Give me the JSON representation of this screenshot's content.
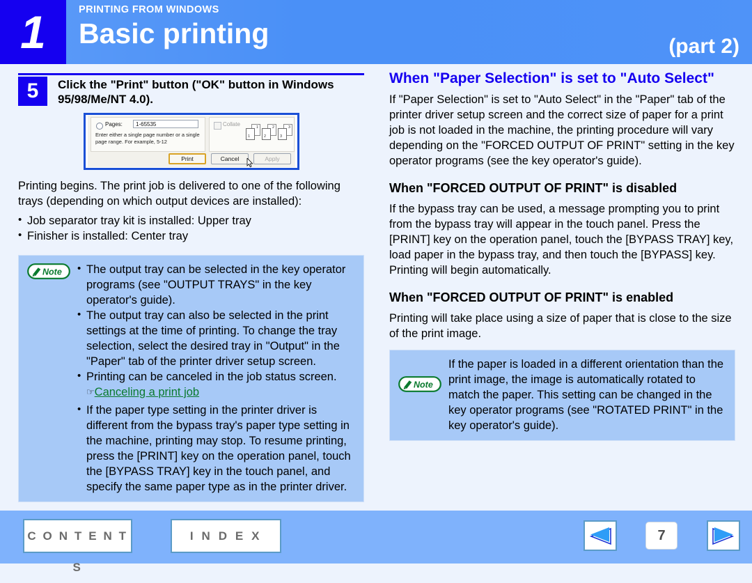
{
  "header": {
    "chapter_number": "1",
    "kicker": "PRINTING FROM WINDOWS",
    "title": "Basic printing",
    "part_label": "(part 2)"
  },
  "left_column": {
    "step": {
      "number": "5",
      "text": "Click the \"Print\" button (\"OK\" button in Windows 95/98/Me/NT 4.0)."
    },
    "dialog_screenshot": {
      "radio_label": "Pages:",
      "page_range_value": "1-65535",
      "hint": "Enter either a single page number or a single page range.  For example, 5-12",
      "collate_label": "Collate",
      "sheet_numbers": [
        "1",
        "1",
        "2",
        "2",
        "3",
        "3"
      ],
      "buttons": {
        "print": "Print",
        "cancel": "Cancel",
        "apply": "Apply"
      }
    },
    "paragraph": "Printing begins. The print job is delivered to one of the following trays (depending on which output devices are installed):",
    "tray_list": [
      "Job separator tray kit is installed: Upper tray",
      "Finisher is installed: Center tray"
    ],
    "note": {
      "badge_label": "Note",
      "bullets": [
        "The output tray can be selected in the key operator programs (see \"OUTPUT TRAYS\" in the key operator's guide).",
        "The output tray can also be selected in the print settings at the time of printing. To change the tray selection, select the desired tray in \"Output\" in the \"Paper\" tab of the printer driver setup screen.",
        "Printing can be canceled in the job status screen.",
        "If the paper type setting in the printer driver is different from the bypass tray's paper type setting in the machine, printing may stop. To resume printing, press the [PRINT] key on the operation panel, touch the [BYPASS TRAY] key in the touch panel, and specify the same paper type as in the printer driver."
      ],
      "cross_reference_link": "Canceling a print job"
    }
  },
  "right_column": {
    "heading_main": "When \"Paper Selection\" is set to \"Auto Select\"",
    "intro_paragraph": "If \"Paper Selection\" is set to \"Auto Select\" in the \"Paper\" tab of the printer driver setup screen and the correct size of paper for a print job is not loaded in the machine, the printing procedure will vary depending on the \"FORCED OUTPUT OF PRINT\" setting in the key operator programs (see the key operator's guide).",
    "heading_disabled": "When \"FORCED OUTPUT OF PRINT\" is disabled",
    "disabled_paragraph": "If the bypass tray can be used, a message prompting you to print from the bypass tray will appear in the touch panel. Press the [PRINT] key on the operation panel, touch the [BYPASS TRAY] key, load paper in the bypass tray, and then touch the [BYPASS] key. Printing will begin automatically.",
    "heading_enabled": "When \"FORCED OUTPUT OF PRINT\" is enabled",
    "enabled_paragraph": "Printing will take place using a size of paper that is close to the size of the print image.",
    "note": {
      "badge_label": "Note",
      "text": "If the paper is loaded in a different orientation than the print image, the image is automatically rotated to match the paper. This setting can be changed in the key operator programs (see \"ROTATED PRINT\" in the key operator's guide)."
    }
  },
  "footer": {
    "contents_label": "C O N T E N T S",
    "index_label": "I N D E X",
    "page_number": "7",
    "prev_icon": "triangle-left-icon",
    "next_icon": "triangle-right-icon"
  },
  "colors": {
    "page_background": "#edf3fd",
    "header_blue": "#4a90f7",
    "accent_blue": "#1500f0",
    "note_background": "#a7c9f7",
    "footer_blue": "#7fb2fc",
    "link_green": "#0a7a2e",
    "nav_arrow_blue": "#2e9df7"
  }
}
